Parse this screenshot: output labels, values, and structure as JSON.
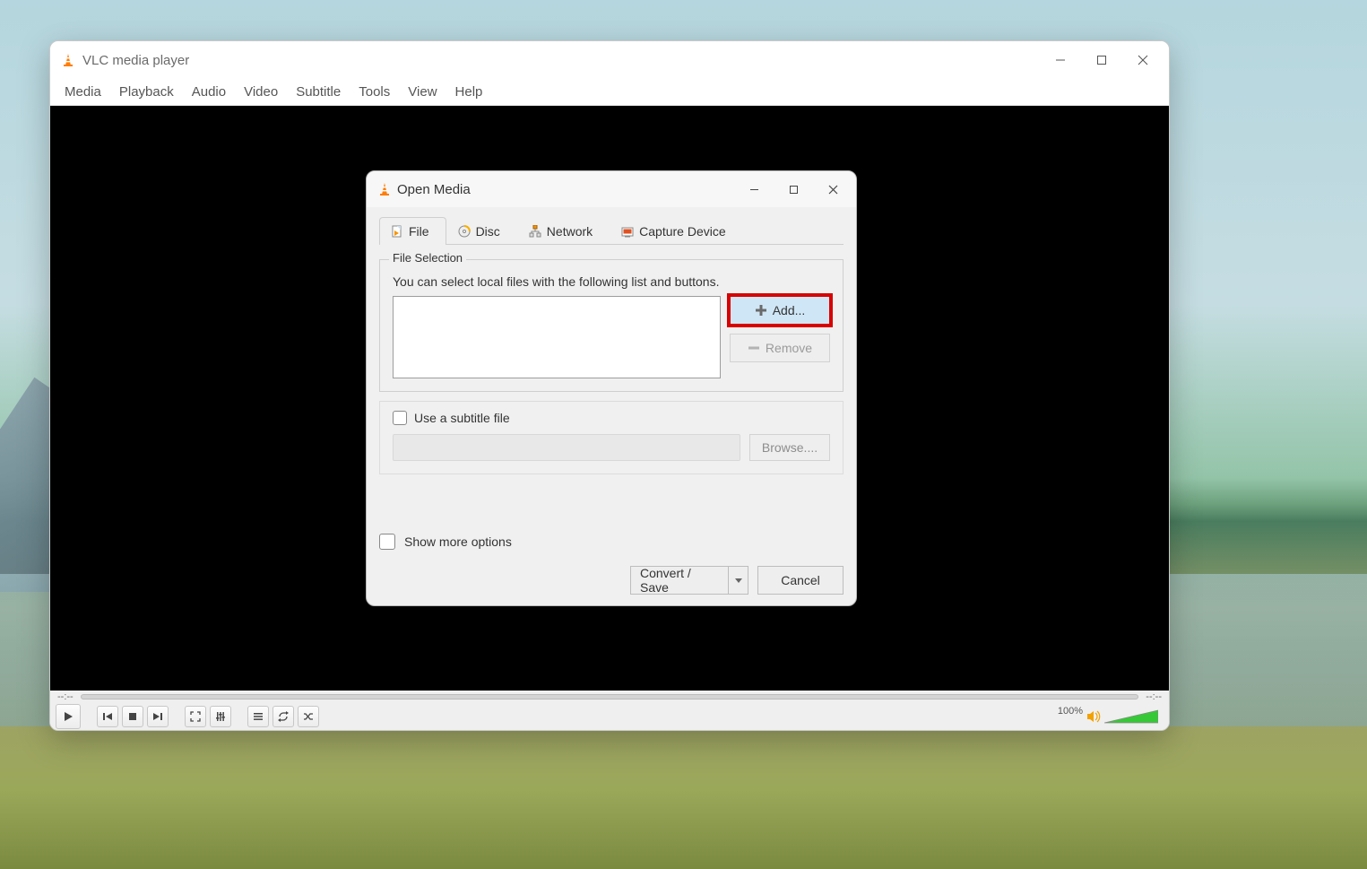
{
  "window": {
    "title": "VLC media player",
    "menus": [
      "Media",
      "Playback",
      "Audio",
      "Video",
      "Subtitle",
      "Tools",
      "View",
      "Help"
    ],
    "time_elapsed": "--:--",
    "time_remaining": "--:--",
    "volume_label": "100%"
  },
  "dialog": {
    "title": "Open Media",
    "tabs": {
      "file": "File",
      "disc": "Disc",
      "network": "Network",
      "capture": "Capture Device"
    },
    "file_section": {
      "legend": "File Selection",
      "hint": "You can select local files with the following list and buttons.",
      "add_label": "Add...",
      "remove_label": "Remove"
    },
    "subtitle": {
      "checkbox_label": "Use a subtitle file",
      "browse_label": "Browse...."
    },
    "more_options_label": "Show more options",
    "convert_label": "Convert / Save",
    "cancel_label": "Cancel"
  }
}
